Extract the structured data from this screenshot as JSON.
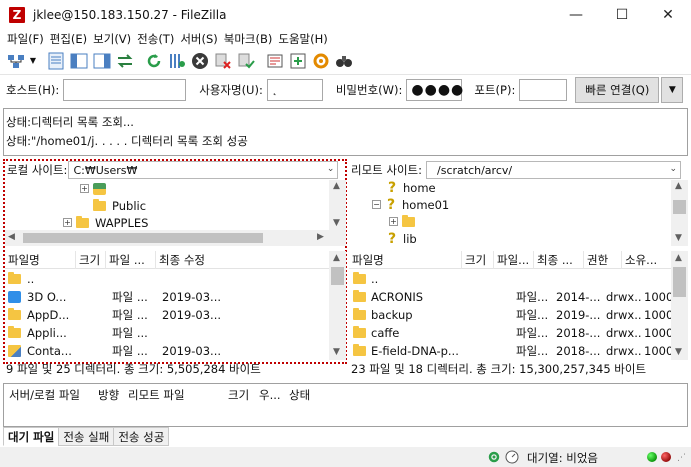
{
  "window": {
    "title": "jklee@150.183.150.27 - FileZilla",
    "minimize": "—",
    "maximize": "☐",
    "close": "✕"
  },
  "menu": [
    "파일(F)",
    "편집(E)",
    "보기(V)",
    "전송(T)",
    "서버(S)",
    "북마크(B)",
    "도움말(H)"
  ],
  "quickconnect": {
    "host_label": "호스트(H):",
    "host_value": "",
    "user_label": "사용자명(U):",
    "user_value": "˛",
    "pass_label": "비밀번호(W):",
    "pass_value": "●●●●",
    "port_label": "포트(P):",
    "port_value": "",
    "connect_label": "빠른 연결(Q)",
    "dropdown": "▼"
  },
  "message_log": [
    "상태:디렉터리 목록 조회...",
    "상태:\"/home01/j. . . . .   디렉터리 목록 조회 성공"
  ],
  "local": {
    "site_label": "로컬 사이트:",
    "site_path": "C:₩Users₩",
    "tree": [
      {
        "expander": "+",
        "label": ""
      },
      {
        "expander": "",
        "label": "Public"
      },
      {
        "expander": "+",
        "label": "WAPPLES"
      }
    ],
    "columns": [
      "파일명",
      "크기",
      "파일 ...",
      "최종 수정"
    ],
    "files": [
      {
        "name": "..",
        "size": "",
        "type": "",
        "modified": ""
      },
      {
        "name": "3D O...",
        "size": "",
        "type": "파일 ...",
        "modified": "2019-03..."
      },
      {
        "name": "AppD...",
        "size": "",
        "type": "파일 ...",
        "modified": "2019-03..."
      },
      {
        "name": "Appli...",
        "size": "",
        "type": "파일 ...",
        "modified": ""
      },
      {
        "name": "Conta...",
        "size": "",
        "type": "파일 ...",
        "modified": "2019-03..."
      }
    ],
    "status": "9 파일 및 25 디렉터리. 총 크기: 5,505,284 바이트"
  },
  "remote": {
    "site_label": "리모트 사이트:",
    "site_path": "/scratch/arcv/",
    "tree": [
      {
        "expander": "",
        "label": "home"
      },
      {
        "expander": "−",
        "label": "home01"
      },
      {
        "expander": "+",
        "label": ""
      },
      {
        "expander": "",
        "label": "lib"
      }
    ],
    "columns": [
      "파일명",
      "크기",
      "파일...",
      "최종 ...",
      "권한",
      "소유..."
    ],
    "files": [
      {
        "name": "..",
        "size": "",
        "type": "",
        "modified": "",
        "perm": "",
        "owner": ""
      },
      {
        "name": "ACRONIS",
        "size": "",
        "type": "파일...",
        "modified": "2014-...",
        "perm": "drwx...",
        "owner": "1000..."
      },
      {
        "name": "backup",
        "size": "",
        "type": "파일...",
        "modified": "2019-...",
        "perm": "drwx...",
        "owner": "1000..."
      },
      {
        "name": "caffe",
        "size": "",
        "type": "파일...",
        "modified": "2018-...",
        "perm": "drwx...",
        "owner": "1000..."
      },
      {
        "name": "E-field-DNA-p...",
        "size": "",
        "type": "파일...",
        "modified": "2018-...",
        "perm": "drwx...",
        "owner": "1000..."
      }
    ],
    "status": "23 파일 및 18 디렉터리. 총 크기: 15,300,257,345 바이트"
  },
  "queue": {
    "columns": [
      "서버/로컬 파일",
      "방향",
      "리모트 파일",
      "크기",
      "우...",
      "상태"
    ]
  },
  "tabs": [
    "대기 파일",
    "전송 실패",
    "전송 성공"
  ],
  "statusbar": {
    "queue_text": "대기열: 비었음"
  },
  "colors": {
    "highlight_border": "#c00000",
    "app_icon": "#bf0000",
    "folder": "#f5c542"
  }
}
